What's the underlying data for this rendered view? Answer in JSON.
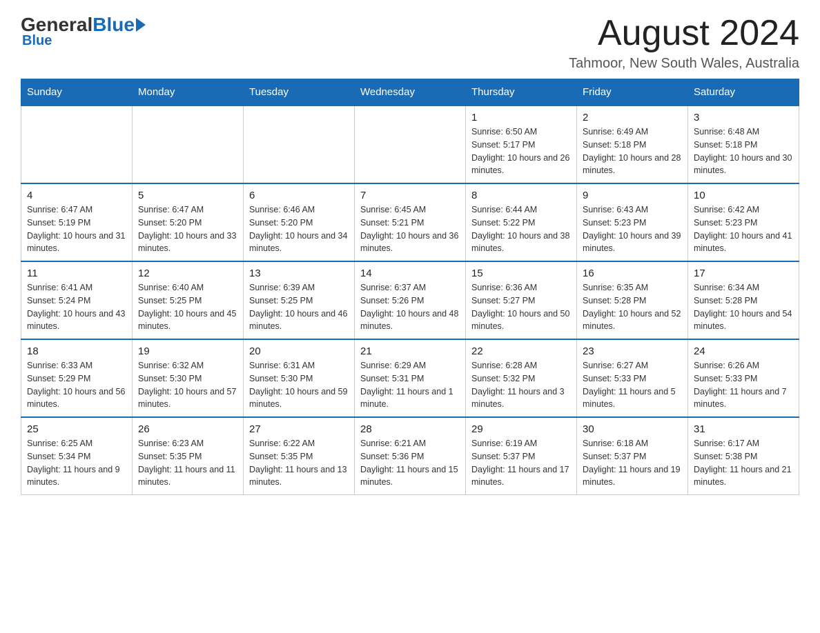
{
  "header": {
    "logo_general": "General",
    "logo_blue": "Blue",
    "month_title": "August 2024",
    "location": "Tahmoor, New South Wales, Australia"
  },
  "days_of_week": [
    "Sunday",
    "Monday",
    "Tuesday",
    "Wednesday",
    "Thursday",
    "Friday",
    "Saturday"
  ],
  "weeks": [
    [
      {
        "day": "",
        "info": ""
      },
      {
        "day": "",
        "info": ""
      },
      {
        "day": "",
        "info": ""
      },
      {
        "day": "",
        "info": ""
      },
      {
        "day": "1",
        "info": "Sunrise: 6:50 AM\nSunset: 5:17 PM\nDaylight: 10 hours and 26 minutes."
      },
      {
        "day": "2",
        "info": "Sunrise: 6:49 AM\nSunset: 5:18 PM\nDaylight: 10 hours and 28 minutes."
      },
      {
        "day": "3",
        "info": "Sunrise: 6:48 AM\nSunset: 5:18 PM\nDaylight: 10 hours and 30 minutes."
      }
    ],
    [
      {
        "day": "4",
        "info": "Sunrise: 6:47 AM\nSunset: 5:19 PM\nDaylight: 10 hours and 31 minutes."
      },
      {
        "day": "5",
        "info": "Sunrise: 6:47 AM\nSunset: 5:20 PM\nDaylight: 10 hours and 33 minutes."
      },
      {
        "day": "6",
        "info": "Sunrise: 6:46 AM\nSunset: 5:20 PM\nDaylight: 10 hours and 34 minutes."
      },
      {
        "day": "7",
        "info": "Sunrise: 6:45 AM\nSunset: 5:21 PM\nDaylight: 10 hours and 36 minutes."
      },
      {
        "day": "8",
        "info": "Sunrise: 6:44 AM\nSunset: 5:22 PM\nDaylight: 10 hours and 38 minutes."
      },
      {
        "day": "9",
        "info": "Sunrise: 6:43 AM\nSunset: 5:23 PM\nDaylight: 10 hours and 39 minutes."
      },
      {
        "day": "10",
        "info": "Sunrise: 6:42 AM\nSunset: 5:23 PM\nDaylight: 10 hours and 41 minutes."
      }
    ],
    [
      {
        "day": "11",
        "info": "Sunrise: 6:41 AM\nSunset: 5:24 PM\nDaylight: 10 hours and 43 minutes."
      },
      {
        "day": "12",
        "info": "Sunrise: 6:40 AM\nSunset: 5:25 PM\nDaylight: 10 hours and 45 minutes."
      },
      {
        "day": "13",
        "info": "Sunrise: 6:39 AM\nSunset: 5:25 PM\nDaylight: 10 hours and 46 minutes."
      },
      {
        "day": "14",
        "info": "Sunrise: 6:37 AM\nSunset: 5:26 PM\nDaylight: 10 hours and 48 minutes."
      },
      {
        "day": "15",
        "info": "Sunrise: 6:36 AM\nSunset: 5:27 PM\nDaylight: 10 hours and 50 minutes."
      },
      {
        "day": "16",
        "info": "Sunrise: 6:35 AM\nSunset: 5:28 PM\nDaylight: 10 hours and 52 minutes."
      },
      {
        "day": "17",
        "info": "Sunrise: 6:34 AM\nSunset: 5:28 PM\nDaylight: 10 hours and 54 minutes."
      }
    ],
    [
      {
        "day": "18",
        "info": "Sunrise: 6:33 AM\nSunset: 5:29 PM\nDaylight: 10 hours and 56 minutes."
      },
      {
        "day": "19",
        "info": "Sunrise: 6:32 AM\nSunset: 5:30 PM\nDaylight: 10 hours and 57 minutes."
      },
      {
        "day": "20",
        "info": "Sunrise: 6:31 AM\nSunset: 5:30 PM\nDaylight: 10 hours and 59 minutes."
      },
      {
        "day": "21",
        "info": "Sunrise: 6:29 AM\nSunset: 5:31 PM\nDaylight: 11 hours and 1 minute."
      },
      {
        "day": "22",
        "info": "Sunrise: 6:28 AM\nSunset: 5:32 PM\nDaylight: 11 hours and 3 minutes."
      },
      {
        "day": "23",
        "info": "Sunrise: 6:27 AM\nSunset: 5:33 PM\nDaylight: 11 hours and 5 minutes."
      },
      {
        "day": "24",
        "info": "Sunrise: 6:26 AM\nSunset: 5:33 PM\nDaylight: 11 hours and 7 minutes."
      }
    ],
    [
      {
        "day": "25",
        "info": "Sunrise: 6:25 AM\nSunset: 5:34 PM\nDaylight: 11 hours and 9 minutes."
      },
      {
        "day": "26",
        "info": "Sunrise: 6:23 AM\nSunset: 5:35 PM\nDaylight: 11 hours and 11 minutes."
      },
      {
        "day": "27",
        "info": "Sunrise: 6:22 AM\nSunset: 5:35 PM\nDaylight: 11 hours and 13 minutes."
      },
      {
        "day": "28",
        "info": "Sunrise: 6:21 AM\nSunset: 5:36 PM\nDaylight: 11 hours and 15 minutes."
      },
      {
        "day": "29",
        "info": "Sunrise: 6:19 AM\nSunset: 5:37 PM\nDaylight: 11 hours and 17 minutes."
      },
      {
        "day": "30",
        "info": "Sunrise: 6:18 AM\nSunset: 5:37 PM\nDaylight: 11 hours and 19 minutes."
      },
      {
        "day": "31",
        "info": "Sunrise: 6:17 AM\nSunset: 5:38 PM\nDaylight: 11 hours and 21 minutes."
      }
    ]
  ]
}
